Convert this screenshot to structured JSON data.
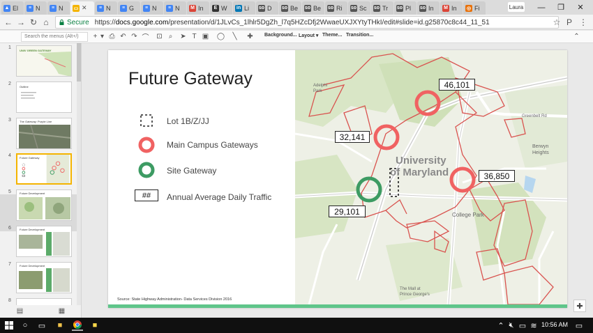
{
  "browser": {
    "tabs": [
      {
        "label": "El",
        "color": "#4285f4",
        "glyph": "▲",
        "active": false
      },
      {
        "label": "N",
        "color": "#4285f4",
        "glyph": "≡",
        "active": false
      },
      {
        "label": "N",
        "color": "#4285f4",
        "glyph": "≡",
        "active": false
      },
      {
        "label": "",
        "color": "#f4b400",
        "glyph": "▭",
        "active": true
      },
      {
        "label": "N",
        "color": "#4285f4",
        "glyph": "≡",
        "active": false
      },
      {
        "label": "G",
        "color": "#4285f4",
        "glyph": "≡",
        "active": false
      },
      {
        "label": "N",
        "color": "#4285f4",
        "glyph": "≡",
        "active": false
      },
      {
        "label": "N",
        "color": "#4285f4",
        "glyph": "≡",
        "active": false
      },
      {
        "label": "In",
        "color": "#db4437",
        "glyph": "M",
        "active": false
      },
      {
        "label": "W",
        "color": "#333333",
        "glyph": "E",
        "active": false
      },
      {
        "label": "Li",
        "color": "#0077b5",
        "glyph": "in",
        "active": false
      },
      {
        "label": "D",
        "color": "#555555",
        "glyph": "so",
        "active": false
      },
      {
        "label": "Be",
        "color": "#555555",
        "glyph": "so",
        "active": false
      },
      {
        "label": "Be",
        "color": "#555555",
        "glyph": "so",
        "active": false
      },
      {
        "label": "Ri",
        "color": "#555555",
        "glyph": "so",
        "active": false
      },
      {
        "label": "Sc",
        "color": "#555555",
        "glyph": "so",
        "active": false
      },
      {
        "label": "Tr",
        "color": "#555555",
        "glyph": "so",
        "active": false
      },
      {
        "label": "Pl",
        "color": "#555555",
        "glyph": "so",
        "active": false
      },
      {
        "label": "In",
        "color": "#555555",
        "glyph": "so",
        "active": false
      },
      {
        "label": "In",
        "color": "#db4437",
        "glyph": "M",
        "active": false
      },
      {
        "label": "Fi",
        "color": "#e8710a",
        "glyph": "◎",
        "active": false
      }
    ],
    "user": "Laura",
    "secure_label": "Secure",
    "url_prefix": "https://",
    "url_host": "docs.google.com",
    "url_path": "/presentation/d/1JLvCs_1lhlr5DgZh_l7q5HZcDfj2WwaeUXJXYtyTHkI/edit#slide=id.g25870c8c44_11_51"
  },
  "toolbar": {
    "search_placeholder": "Search the menus (Alt+/)",
    "background": "Background...",
    "layout": "Layout ▾",
    "theme": "Theme...",
    "transition": "Transition..."
  },
  "filmstrip": {
    "slides": [
      {
        "num": "1",
        "caption": "UNIV GREEN GATEWAY"
      },
      {
        "num": "2",
        "caption": "Outline"
      },
      {
        "num": "3",
        "caption": "The Gateway: Purple Line"
      },
      {
        "num": "4",
        "caption": "Future Gateway"
      },
      {
        "num": "5",
        "caption": "Future Development"
      },
      {
        "num": "6",
        "caption": "Future Development"
      },
      {
        "num": "7",
        "caption": "Future Development"
      },
      {
        "num": "8",
        "caption": ""
      }
    ]
  },
  "slide": {
    "title": "Future Gateway",
    "legend": {
      "lot": "Lot 1B/Z/JJ",
      "main_campus": "Main Campus Gateways",
      "site_gateway": "Site Gateway",
      "traffic_symbol": "##",
      "traffic": "Annual Average Daily Traffic"
    },
    "source": "Source: State Highway Administration- Data Services Division 2016",
    "map": {
      "university": "University",
      "of_maryland": "of Maryland",
      "counts": {
        "north": "46,101",
        "west": "32,141",
        "east": "36,850",
        "south": "29,101"
      },
      "places": {
        "berwyn": "Berwyn",
        "heights": "Heights",
        "adelphi": "Adelphi",
        "park": "Park",
        "greenbelt_rd": "Greenbelt Rd",
        "college_park": "College Park",
        "mall": "The Mall at",
        "prince": "Prince George's"
      }
    },
    "colors": {
      "gateway_red": "#f06262",
      "site_green": "#3d9b63",
      "boundary": "#d9534f"
    }
  },
  "taskbar": {
    "time": "10:56 AM"
  }
}
